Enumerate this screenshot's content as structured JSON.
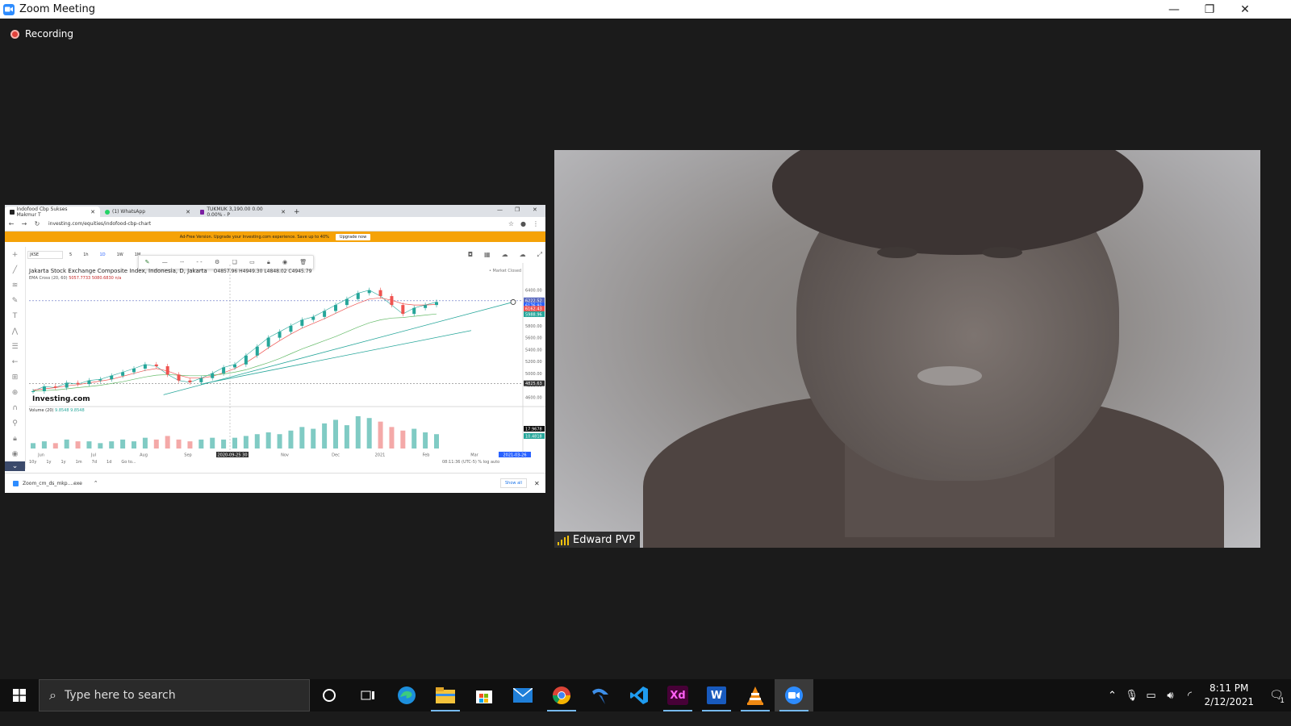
{
  "window": {
    "title": "Zoom Meeting",
    "minimize": "—",
    "restore": "❐",
    "close": "✕"
  },
  "recording": {
    "label": "Recording"
  },
  "browser": {
    "tabs": [
      {
        "label": "Indofood Cbp Sukses Makmur T",
        "color": "#222222"
      },
      {
        "label": "(1) WhatsApp",
        "color": "#25d366"
      },
      {
        "label": "TUKMUK 3,190.00 0.00 0.00% - P",
        "color": "#7b1fa2"
      }
    ],
    "url": "investing.com/equities/indofood-cbp-chart",
    "promo_text": "Ad-Free Version. Upgrade your Investing.com experience. Save up to 40%",
    "promo_button": "Upgrade now",
    "download_file": "Zoom_cm_ds_mkp....exe",
    "show_all": "Show all"
  },
  "chart_toolbar": {
    "symbol": "JKSE",
    "timeframes": [
      "5",
      "1h",
      "1D",
      "1W",
      "1M"
    ]
  },
  "chart_legend": {
    "title": "Jakarta Stock Exchange Composite Index, Indonesia, D, Jakarta",
    "ohlc": "O4857.96  H4949.30  L4848.02  C4945.79",
    "indicator": "EMA Cross (20, 60)",
    "indicator_values": "5057.7733   5080.6830   n/a",
    "market_status": "• Market Closed",
    "volume_label": "Volume (20)",
    "volume_values": "9.8548   9.8548",
    "brand": "Investing.com",
    "bottom_ranges": [
      "10y",
      "1y",
      "1y",
      "1m",
      "7d",
      "1d",
      "Go to..."
    ],
    "bottom_right": "08:11:36 (UTC-5)    %    log    auto"
  },
  "chart_data": {
    "type": "line",
    "title": "Jakarta Stock Exchange Composite Index, Indonesia, D, Jakarta",
    "x_ticks": [
      "Jun",
      "Jul",
      "Aug",
      "Sep",
      "2020-09-25 30",
      "Nov",
      "Dec",
      "2021",
      "Feb",
      "Mar",
      "2021-03-26"
    ],
    "y_ticks": [
      4600,
      4800,
      5000,
      5200,
      5400,
      5600,
      5800,
      6000,
      6200,
      6400
    ],
    "price_labels": [
      "6222.52",
      "6176.91",
      "6162.43",
      "5988.96",
      "4825.63"
    ],
    "volume_labels": [
      "17.9678",
      "10.4818"
    ],
    "series": [
      {
        "name": "Close",
        "color": "#26a69a",
        "values": [
          4700,
          4780,
          4760,
          4840,
          4820,
          4880,
          4900,
          4960,
          5020,
          5080,
          5150,
          5120,
          4980,
          4880,
          4850,
          4920,
          5000,
          5100,
          5150,
          5300,
          5450,
          5600,
          5700,
          5800,
          5900,
          5950,
          6050,
          6150,
          6250,
          6350,
          6400,
          6300,
          6150,
          6000,
          6100,
          6150,
          6200
        ]
      },
      {
        "name": "EMA 20",
        "color": "#ef5350",
        "values": [
          4720,
          4740,
          4760,
          4790,
          4810,
          4840,
          4870,
          4900,
          4950,
          5000,
          5050,
          5080,
          5040,
          4970,
          4920,
          4920,
          4950,
          5010,
          5080,
          5180,
          5300,
          5430,
          5550,
          5660,
          5760,
          5840,
          5920,
          6010,
          6100,
          6180,
          6250,
          6270,
          6230,
          6170,
          6150,
          6150,
          6160
        ]
      },
      {
        "name": "EMA 60",
        "color": "#66bb6a",
        "values": [
          4700,
          4710,
          4720,
          4740,
          4760,
          4780,
          4800,
          4830,
          4860,
          4900,
          4940,
          4970,
          4980,
          4970,
          4960,
          4960,
          4970,
          4990,
          5020,
          5060,
          5120,
          5180,
          5250,
          5330,
          5410,
          5480,
          5550,
          5620,
          5700,
          5780,
          5850,
          5900,
          5930,
          5940,
          5960,
          5980,
          6000
        ]
      }
    ],
    "volume": [
      3,
      4,
      3,
      5,
      4,
      4,
      3,
      4,
      5,
      4,
      6,
      5,
      7,
      5,
      4,
      5,
      6,
      5,
      6,
      7,
      8,
      9,
      8,
      10,
      12,
      11,
      14,
      16,
      13,
      18,
      17,
      15,
      12,
      10,
      11,
      9,
      8
    ]
  },
  "participant": {
    "name": "Edward PVP"
  },
  "taskbar": {
    "search_placeholder": "Type here to search",
    "time": "8:11 PM",
    "date": "2/12/2021",
    "notification_count": "1"
  },
  "colors": {
    "zoom_blue": "#2d8cff",
    "recording_red": "#e0413a",
    "promo_orange": "#f5a208"
  }
}
